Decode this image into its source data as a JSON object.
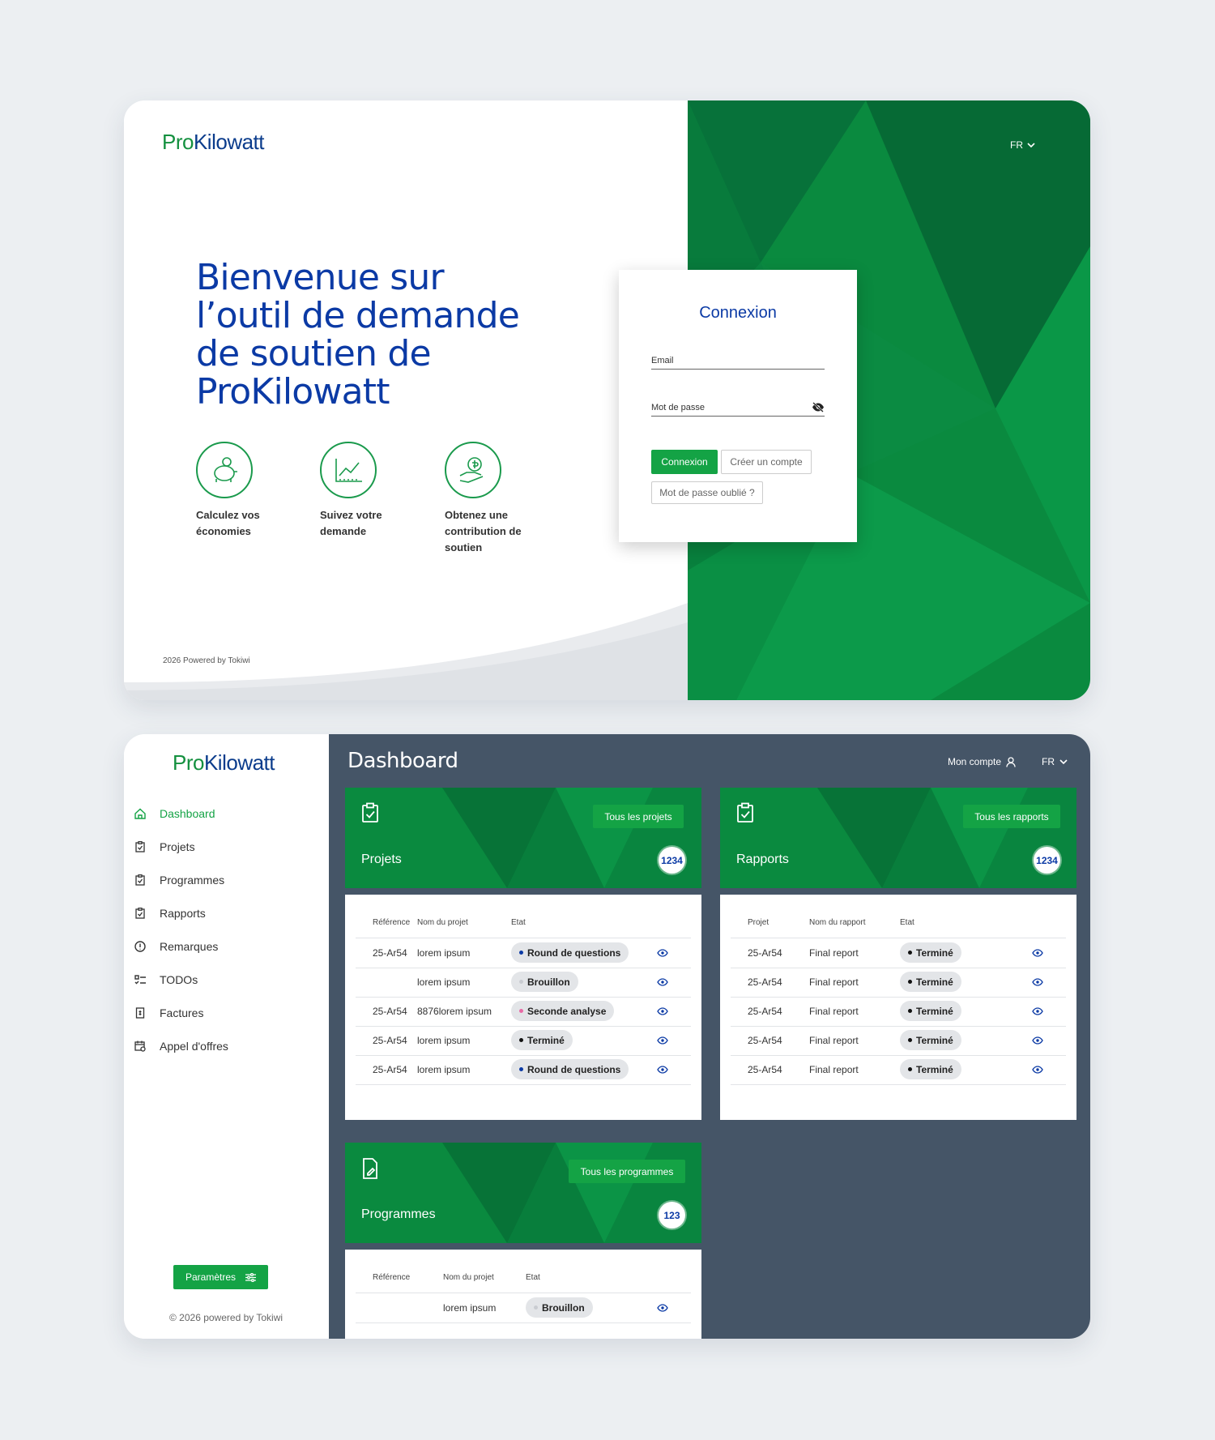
{
  "brand": {
    "pro": "Pro",
    "kilowatt": "Kilowatt"
  },
  "login": {
    "language": "FR",
    "welcome": "Bienvenue sur l’outil de demande de soutien de ProKilowatt",
    "features": [
      {
        "label": "Calculez vos économies",
        "icon": "piggy-bank-icon"
      },
      {
        "label": "Suivez votre demande",
        "icon": "chart-line-icon"
      },
      {
        "label": "Obtenez une contribution de soutien",
        "icon": "hand-dollar-icon"
      }
    ],
    "footer": "2026 Powered by Tokiwi",
    "modal": {
      "title": "Connexion",
      "email_label": "Email",
      "password_label": "Mot de passe",
      "login_button": "Connexion",
      "create_account_button": "Créer un compte",
      "forgot_button": "Mot de passe oublié ?"
    }
  },
  "dashboard": {
    "title": "Dashboard",
    "account": "Mon compte",
    "language": "FR",
    "nav": [
      {
        "label": "Dashboard",
        "icon": "home-icon",
        "active": true
      },
      {
        "label": "Projets",
        "icon": "clipboard-check-icon"
      },
      {
        "label": "Programmes",
        "icon": "clipboard-check-icon"
      },
      {
        "label": "Rapports",
        "icon": "clipboard-check-icon"
      },
      {
        "label": "Remarques",
        "icon": "info-circle-icon"
      },
      {
        "label": "TODOs",
        "icon": "checklist-icon"
      },
      {
        "label": "Factures",
        "icon": "invoice-icon"
      },
      {
        "label": "Appel d'offres",
        "icon": "calendar-icon"
      }
    ],
    "settings_button": "Paramètres",
    "copyright": "© 2026 powered by Tokiwi",
    "status_colors": {
      "blue": "#0b3aa5",
      "grey": "#c9ccd1",
      "pink": "#e86aa6",
      "black": "#111111"
    },
    "projects": {
      "title": "Projets",
      "button": "Tous les projets",
      "count": "1234",
      "headers": [
        "Référence",
        "Nom du projet",
        "Etat"
      ],
      "rows": [
        {
          "ref": "25-Ar54",
          "name": "lorem ipsum",
          "status": "Round de questions",
          "dot": "blue"
        },
        {
          "ref": "",
          "name": "lorem ipsum",
          "status": "Brouillon",
          "dot": "grey"
        },
        {
          "ref": "25-Ar54",
          "name": "8876lorem ipsum",
          "status": "Seconde analyse",
          "dot": "pink"
        },
        {
          "ref": "25-Ar54",
          "name": "lorem ipsum",
          "status": "Terminé",
          "dot": "black"
        },
        {
          "ref": "25-Ar54",
          "name": "lorem ipsum",
          "status": "Round de questions",
          "dot": "blue"
        }
      ]
    },
    "reports": {
      "title": "Rapports",
      "button": "Tous les rapports",
      "count": "1234",
      "headers": [
        "Projet",
        "Nom du rapport",
        "Etat"
      ],
      "rows": [
        {
          "ref": "25-Ar54",
          "name": "Final report",
          "status": "Terminé",
          "dot": "black"
        },
        {
          "ref": "25-Ar54",
          "name": "Final report",
          "status": "Terminé",
          "dot": "black"
        },
        {
          "ref": "25-Ar54",
          "name": "Final report",
          "status": "Terminé",
          "dot": "black"
        },
        {
          "ref": "25-Ar54",
          "name": "Final report",
          "status": "Terminé",
          "dot": "black"
        },
        {
          "ref": "25-Ar54",
          "name": "Final report",
          "status": "Terminé",
          "dot": "black"
        }
      ]
    },
    "programmes": {
      "title": "Programmes",
      "button": "Tous les programmes",
      "count": "123",
      "headers": [
        "Référence",
        "Nom du projet",
        "Etat"
      ],
      "rows": [
        {
          "ref": "",
          "name": "lorem ipsum",
          "status": "Brouillon",
          "dot": "grey"
        }
      ]
    }
  }
}
